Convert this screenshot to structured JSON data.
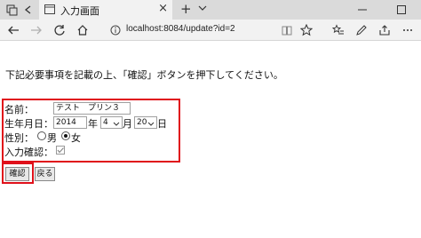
{
  "tab": {
    "title": "入力画面"
  },
  "address": {
    "url": "localhost:8084/update?id=2"
  },
  "instruction": "下記必要事項を記載の上、「確認」ボタンを押下してください。",
  "form": {
    "name_label": "名前：",
    "name_value": "テスト　プリン３",
    "birth_label": "生年月日：",
    "year_value": "2014",
    "year_unit": "年",
    "month_value": "4",
    "month_unit": "月",
    "day_value": "20",
    "day_unit": "日",
    "gender_label": "性別：",
    "gender_options": [
      "男",
      "女"
    ],
    "gender_selected": "女",
    "confirm_label": "入力確認：",
    "confirm_checked": true
  },
  "buttons": {
    "confirm": "確認",
    "back": "戻る"
  }
}
